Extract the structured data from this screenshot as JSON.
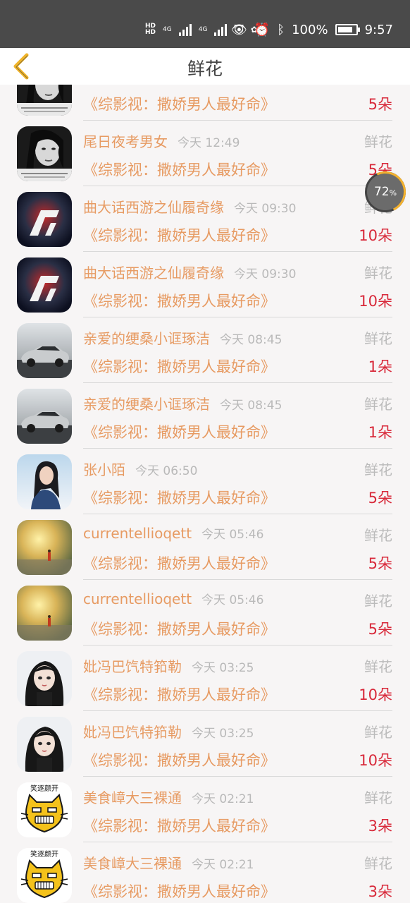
{
  "status_bar": {
    "net_left": "4G",
    "net_right": "4G",
    "battery": "100%",
    "time": "9:57"
  },
  "header": {
    "title": "鲜花"
  },
  "badge": {
    "value": "72",
    "unit": "%"
  },
  "rows": [
    {
      "name": "",
      "time": "",
      "type": "",
      "work": "《综影视：撒娇男人最好命》",
      "count": "5朵",
      "avatar": "woman-bw"
    },
    {
      "name": "尾日夜考男女",
      "time": "今天 12:49",
      "type": "鲜花",
      "work": "《综影视：撒娇男人最好命》",
      "count": "5朵",
      "avatar": "woman-bw"
    },
    {
      "name": "曲大话西游之仙履奇缘",
      "time": "今天 09:30",
      "type": "鲜花",
      "work": "《综影视：撒娇男人最好命》",
      "count": "10朵",
      "avatar": "nfs-logo"
    },
    {
      "name": "曲大话西游之仙履奇缘",
      "time": "今天 09:30",
      "type": "鲜花",
      "work": "《综影视：撒娇男人最好命》",
      "count": "10朵",
      "avatar": "nfs-logo"
    },
    {
      "name": "亲爱的绠桑小诓琢洁",
      "time": "今天 08:45",
      "type": "鲜花",
      "work": "《综影视：撒娇男人最好命》",
      "count": "1朵",
      "avatar": "car"
    },
    {
      "name": "亲爱的绠桑小诓琢洁",
      "time": "今天 08:45",
      "type": "鲜花",
      "work": "《综影视：撒娇男人最好命》",
      "count": "1朵",
      "avatar": "car"
    },
    {
      "name": "张小陌",
      "time": "今天 06:50",
      "type": "鲜花",
      "work": "《综影视：撒娇男人最好命》",
      "count": "5朵",
      "avatar": "girl-blue"
    },
    {
      "name": "currentellioqett",
      "time": "今天 05:46",
      "type": "鲜花",
      "work": "《综影视：撒娇男人最好命》",
      "count": "5朵",
      "avatar": "sunset"
    },
    {
      "name": "currentellioqett",
      "time": "今天 05:46",
      "type": "鲜花",
      "work": "《综影视：撒娇男人最好命》",
      "count": "5朵",
      "avatar": "sunset"
    },
    {
      "name": "妣冯巴饩特筘勒",
      "time": "今天 03:25",
      "type": "鲜花",
      "work": "《综影视：撒娇男人最好命》",
      "count": "10朵",
      "avatar": "girl-illust"
    },
    {
      "name": "妣冯巴饩特筘勒",
      "time": "今天 03:25",
      "type": "鲜花",
      "work": "《综影视：撒娇男人最好命》",
      "count": "10朵",
      "avatar": "girl-illust"
    },
    {
      "name": "美食嶂大三裸通",
      "time": "今天 02:21",
      "type": "鲜花",
      "work": "《综影视：撒娇男人最好命》",
      "count": "3朵",
      "avatar": "cat-cartoon"
    },
    {
      "name": "美食嶂大三裸通",
      "time": "今天 02:21",
      "type": "鲜花",
      "work": "《综影视：撒娇男人最好命》",
      "count": "3朵",
      "avatar": "cat-cartoon"
    }
  ]
}
